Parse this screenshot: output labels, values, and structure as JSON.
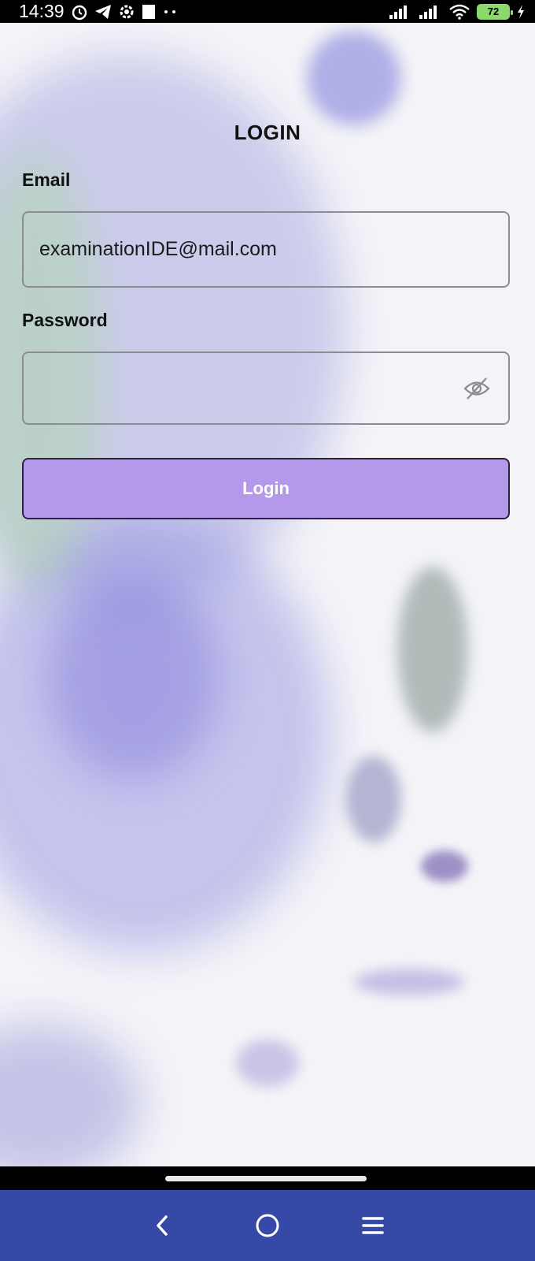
{
  "status_bar": {
    "time": "14:39",
    "battery_level": "72",
    "icons": [
      "alarm-icon",
      "telegram-icon",
      "settings-icon",
      "square-icon",
      "dots-icon",
      "signal-icon",
      "signal-icon",
      "wifi-icon",
      "battery-icon",
      "charging-icon"
    ]
  },
  "login": {
    "title": "LOGIN",
    "email_label": "Email",
    "email_value": "examinationIDE@mail.com",
    "password_label": "Password",
    "password_value": "",
    "password_toggle_icon": "eye-off-icon",
    "button_label": "Login"
  },
  "navigation": {
    "icons": [
      "back-icon",
      "home-icon",
      "menu-icon"
    ]
  },
  "colors": {
    "button_bg": "#b498eb",
    "nav_bar_bg": "#3749a7",
    "battery": "#8bd96a"
  }
}
